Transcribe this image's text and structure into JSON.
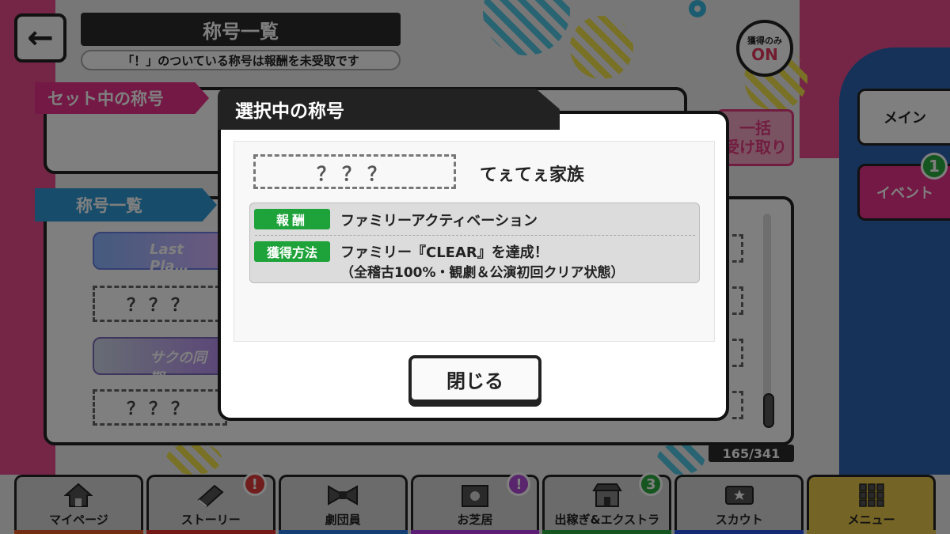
{
  "header": {
    "title": "称号一覧",
    "note": "「！」のついている称号は報酬を未受取です",
    "back_icon": "←",
    "filter_toggle": {
      "label": "獲得のみ",
      "state": "ON"
    }
  },
  "set_panel": {
    "label": "セット中の称号",
    "claim_button": {
      "line1": "一括",
      "line2": "受け取り"
    }
  },
  "list_panel": {
    "label": "称号一覧",
    "badges": [
      "Last Pla…",
      "サクの同期…"
    ],
    "unknown_placeholder": "？？？",
    "counter": "165/341"
  },
  "side_tabs": [
    {
      "label": "メイン"
    },
    {
      "label": "イベント",
      "badge": "1"
    }
  ],
  "modal": {
    "header": "選択中の称号",
    "unknown_title": "？？？",
    "title_name": "てぇてぇ家族",
    "reward_tag": "報酬",
    "reward_text": "ファミリーアクティベーション",
    "method_tag": "獲得方法",
    "method_line1": "ファミリー『CLEAR』を達成！",
    "method_line2": "（全稽古100%・観劇＆公演初回クリア状態）",
    "close_label": "閉じる"
  },
  "nav": [
    {
      "label": "マイページ",
      "icon": "home-icon",
      "bar_color": "#e85a2a"
    },
    {
      "label": "ストーリー",
      "icon": "book-icon",
      "bar_color": "#e8322a",
      "notice": "!",
      "notice_color": "#e23a3a"
    },
    {
      "label": "劇団員",
      "icon": "bowtie-icon",
      "bar_color": "#2a7ee8"
    },
    {
      "label": "お芝居",
      "icon": "theater-icon",
      "bar_color": "#b83ae8",
      "notice": "!",
      "notice_color": "#b24ad8"
    },
    {
      "label": "出稼ぎ&エクストラ",
      "icon": "shop-icon",
      "bar_color": "#2aaa3e",
      "notice": "3",
      "notice_color": "#2aaa3e"
    },
    {
      "label": "スカウト",
      "icon": "ticket-icon",
      "bar_color": "#2a55e8"
    },
    {
      "label": "メニュー",
      "icon": "grid-icon",
      "bar_color": "#e8c84a"
    }
  ],
  "colors": {
    "accent_pink": "#e8328a",
    "accent_blue": "#2e9ad6",
    "tag_green": "#1ea23a"
  }
}
